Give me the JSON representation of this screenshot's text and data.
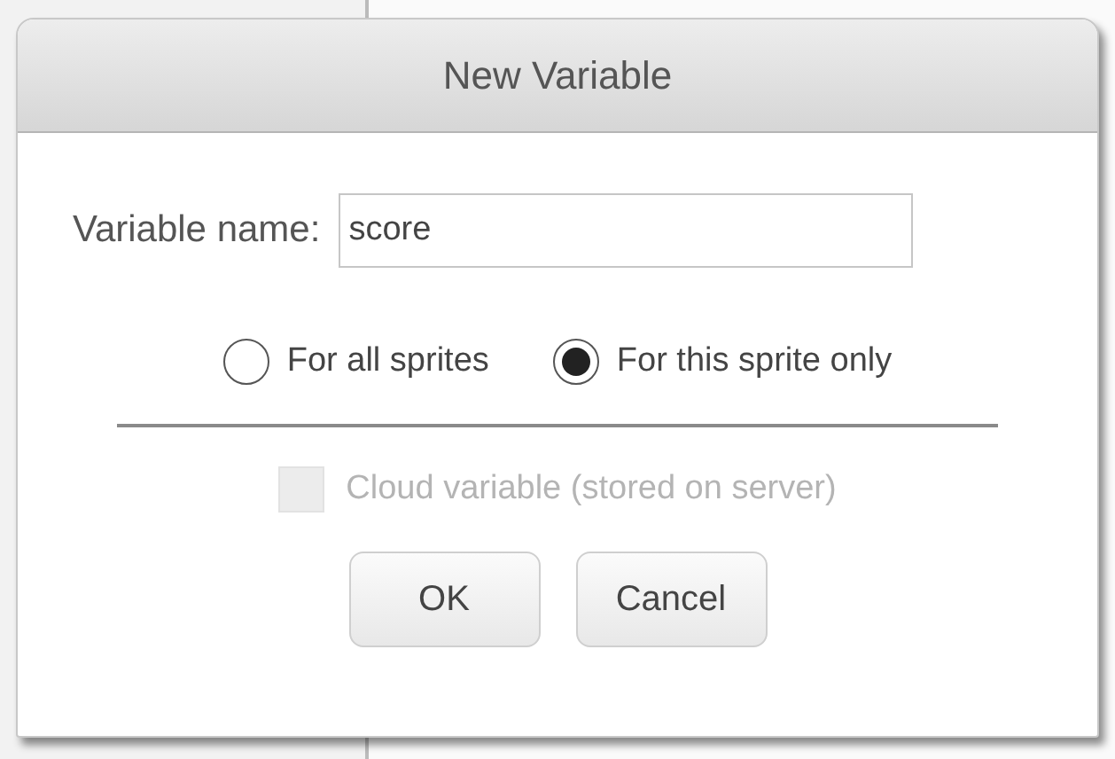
{
  "dialog": {
    "title": "New Variable",
    "name_field": {
      "label": "Variable name:",
      "value": "score"
    },
    "scope": [
      {
        "label": "For all sprites",
        "selected": false
      },
      {
        "label": "For this sprite only",
        "selected": true
      }
    ],
    "cloud": {
      "label": "Cloud variable (stored on server)",
      "checked": false,
      "disabled": true
    },
    "buttons": [
      "OK",
      "Cancel"
    ]
  }
}
